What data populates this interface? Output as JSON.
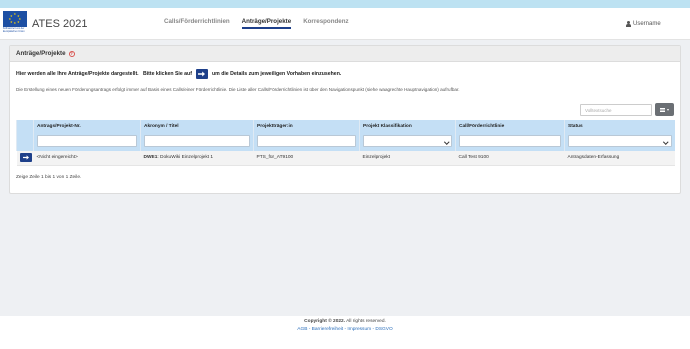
{
  "header": {
    "logo_caption": "Kofinanziert von der Europäischen Union",
    "app_title": "ATES 2021",
    "nav": [
      {
        "label": "Calls/Förderrichtlinien",
        "active": false
      },
      {
        "label": "Anträge/Projekte",
        "active": true
      },
      {
        "label": "Korrespondenz",
        "active": false
      }
    ],
    "user": "Username"
  },
  "panel": {
    "title": "Anträge/Projekte",
    "help_icon": "?",
    "intro_before": "Hier werden alle Ihre Anträge/Projekte dargestellt.   Bitte klicken Sie auf",
    "intro_after": "um die Details zum jeweiligen Vorhaben einzusehen.",
    "info": "Die Erstellung eines neuen Förderungsantrags erfolgt immer auf Basis eines Calls/einer Förderrichtlinie. Die Liste aller Calls/Förderrichtlinien ist über den Navigationspunkt (siehe waagrechte Hauptnavigation) aufrufbar.",
    "search_placeholder": "Volltextsuche",
    "columns_button_icon": "list-icon"
  },
  "table": {
    "headers": [
      "",
      "Antrags/Projekt-Nr.",
      "Akronym / Titel",
      "Projektträger:in",
      "Projekt Klassifikation",
      "Call/Förderrichtlinie",
      "Status"
    ],
    "rows": [
      {
        "nr": "<Nicht eingereicht>",
        "acronym": "DWE1",
        "title": ": DokuWiki Einzelprojekt 1",
        "traeger": "PTS_für_AT9100",
        "klassifikation": "Einzelprojekt",
        "call": "Call Test 9100",
        "status": "Antragsdaten-Erfassung"
      }
    ],
    "summary": "Zeige Zeile 1 bis 1 von 1 Zeile."
  },
  "footer": {
    "copyright_bold": "Copyright © 2022.",
    "copyright_rest": " All rights reserved.",
    "links": "AGB - Barrierefreiheit - Impressum - DSGVO"
  },
  "colors": {
    "primary": "#1d3f8a",
    "table_header": "#c4dff5",
    "top_strip": "#bde2f2"
  }
}
